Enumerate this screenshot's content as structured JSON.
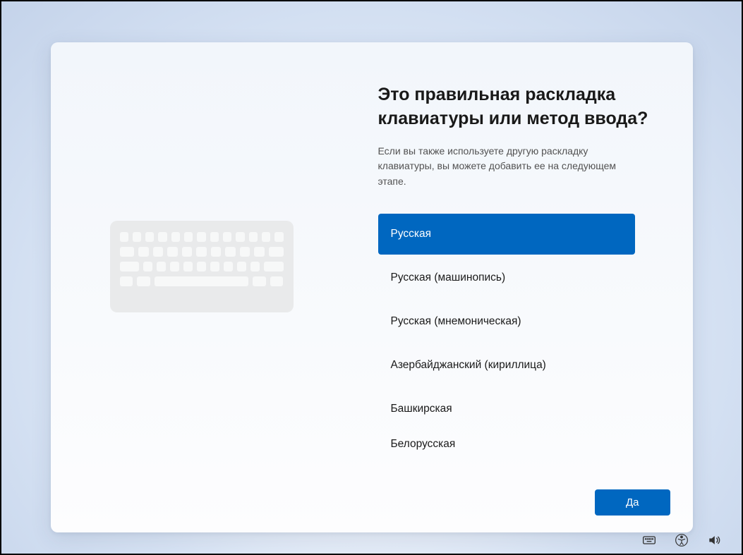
{
  "title": "Это правильная раскладка клавиатуры или метод ввода?",
  "subtitle": "Если вы также используете другую раскладку клавиатуры, вы можете добавить ее на следующем этапе.",
  "layouts": [
    {
      "label": "Русская",
      "selected": true
    },
    {
      "label": "Русская (машинопись)",
      "selected": false
    },
    {
      "label": "Русская (мнемоническая)",
      "selected": false
    },
    {
      "label": "Азербайджанский (кириллица)",
      "selected": false
    },
    {
      "label": "Башкирская",
      "selected": false
    },
    {
      "label": "Белорусская",
      "selected": false
    }
  ],
  "yes_button": "Да",
  "colors": {
    "accent": "#0067c0"
  }
}
